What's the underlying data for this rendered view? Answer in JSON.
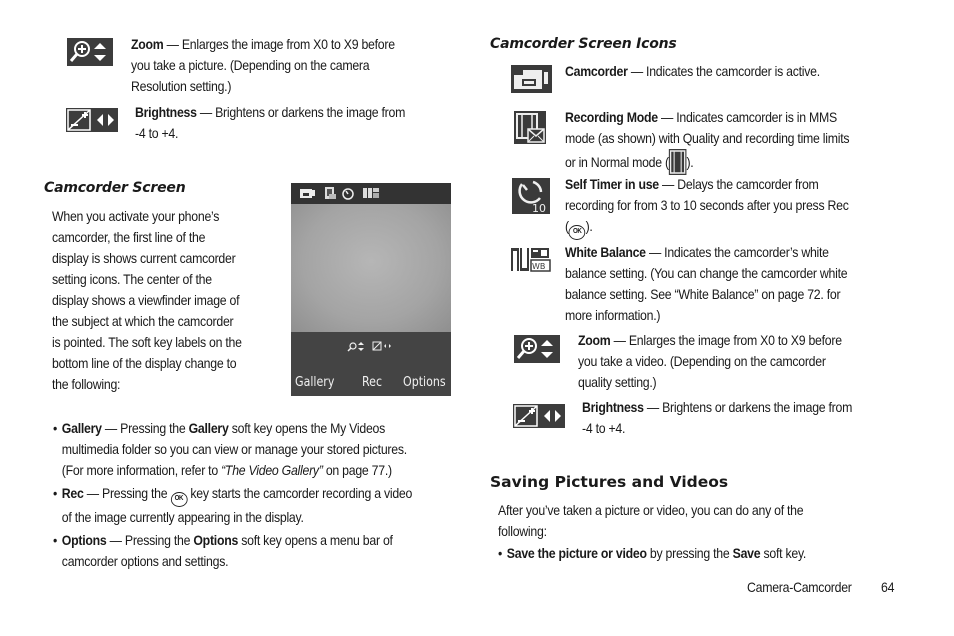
{
  "left_column": {
    "zoom_item": {
      "icon": "zoom-icon",
      "term": "Zoom",
      "lines": [
        " — Enlarges the image from X0 to X9 before",
        "you take a picture. (Depending on the camera",
        "Resolution setting.)"
      ]
    },
    "brightness_item": {
      "icon": "brightness-icon",
      "term": "Brightness",
      "lines": [
        " — Brightens or darkens the image from",
        "-4 to +4."
      ]
    },
    "camcorder_screen": {
      "heading": "Camcorder Screen",
      "paragraph_lines": [
        "When you activate your phone’s",
        "camcorder, the first line of the",
        "display is shows current camcorder",
        "setting icons. The center of the",
        "display shows a viewfinder image of",
        "the subject at which the camcorder",
        "is pointed. The soft key labels on the",
        "bottom line of the display change to",
        "the following:"
      ]
    },
    "phone_screen": {
      "status_icons": [
        "camcorder-icon",
        "recording-mode-icon",
        "self-timer-icon",
        "white-balance-icon"
      ],
      "softkeys": {
        "left": "Gallery",
        "center": "Rec",
        "right": "Options"
      }
    },
    "bullets": [
      {
        "term": "Gallery",
        "line1_a": " — Pressing the ",
        "line1_b": "Gallery",
        "line1_c": " soft key opens the My Videos",
        "line2": "multimedia folder so you can view or manage your stored pictures.",
        "line3_a": "(For more information, refer to ",
        "line3_ref": "“The Video Gallery”",
        "line3_b": "  on page 77.)"
      },
      {
        "term": "Rec",
        "line1_a": " — Pressing the ",
        "key": "OK",
        "line1_b": " key starts the camcorder recording a video",
        "line2": "of the image currently appearing in the display."
      },
      {
        "term": "Options",
        "line1_a": " — Pressing the ",
        "line1_b": "Options",
        "line1_c": " soft key opens a menu bar of",
        "line2": "camcorder options and settings."
      }
    ]
  },
  "right_column": {
    "heading": "Camcorder Screen Icons",
    "items": [
      {
        "icon": "camcorder-icon",
        "term": "Camcorder",
        "lines": [
          " — Indicates the camcorder is active."
        ]
      },
      {
        "icon": "recording-mode-icon",
        "term": "Recording Mode",
        "lines": [
          " — Indicates camcorder is in MMS",
          "mode (as shown) with Quality and recording time limits",
          "or in Normal mode (",
          ")."
        ]
      },
      {
        "icon": "self-timer-icon",
        "term": "Self Timer in use",
        "lines": [
          " — Delays the camcorder from",
          "recording for from 3 to 10 seconds after you press Rec",
          "(",
          ")."
        ],
        "key": "OK"
      },
      {
        "icon": "white-balance-icon",
        "term": "White Balance",
        "lines": [
          " — Indicates the camcorder’s white",
          "balance setting. (You can change the camcorder white",
          "balance setting. See “White Balance” on page 72. for",
          "more information.)"
        ]
      },
      {
        "icon": "zoom-icon",
        "term": "Zoom",
        "lines": [
          " — Enlarges the image from X0 to X9 before",
          "you take a video. (Depending on the camcorder",
          "quality setting.)"
        ]
      },
      {
        "icon": "brightness-icon",
        "term": "Brightness",
        "lines": [
          " — Brightens or darkens the image from",
          "-4 to +4."
        ]
      }
    ],
    "saving": {
      "heading": "Saving Pictures and Videos",
      "paragraph_lines": [
        "After you’ve taken a picture or video, you can do any of the",
        "following:"
      ],
      "bullet_term": "Save the picture or video",
      "bullet_a": " by pressing the ",
      "bullet_b": "Save",
      "bullet_c": " soft key."
    }
  },
  "footer": {
    "section": "Camera-Camcorder",
    "page_number": "64"
  }
}
